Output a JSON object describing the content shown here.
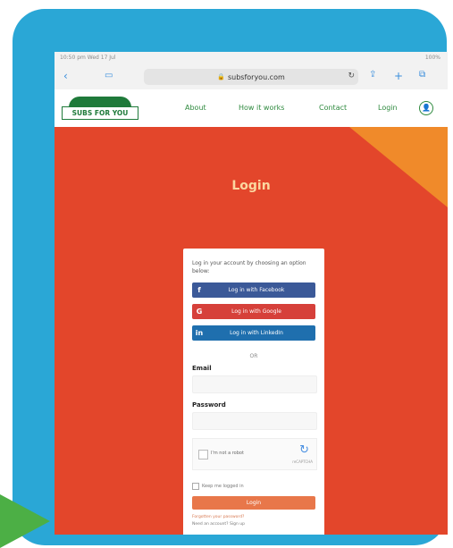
{
  "status": {
    "time": "10:50 pm Wed 17 Jul",
    "battery": "100%"
  },
  "browser": {
    "url": "subsforyou.com"
  },
  "site": {
    "logo_text": "SUBS FOR YOU",
    "nav": [
      "About",
      "How it works",
      "Contact",
      "Login"
    ]
  },
  "page": {
    "title": "Login",
    "intro": "Log in your account by choosing an option below:",
    "social": [
      {
        "label": "Log in with Facebook",
        "icon": "f"
      },
      {
        "label": "Log in with Google",
        "icon": "G"
      },
      {
        "label": "Log in with LinkedIn",
        "icon": "in"
      }
    ],
    "or": "OR",
    "email_label": "Email",
    "password_label": "Password",
    "captcha_text": "I'm not a robot",
    "captcha_brand": "reCAPTCHA",
    "remember_label": "Keep me logged in",
    "login_button": "Login",
    "forgot_text": "Forgotten your password?",
    "signup_text": "Need an account? Sign up"
  },
  "colors": {
    "frame": "#2aa7d6",
    "hero": "#e3462b",
    "accent_orange": "#f08a2a",
    "brand_green": "#1f7a3a",
    "facebook": "#3b5998",
    "google": "#d6403a",
    "linkedin": "#1f6fae"
  }
}
